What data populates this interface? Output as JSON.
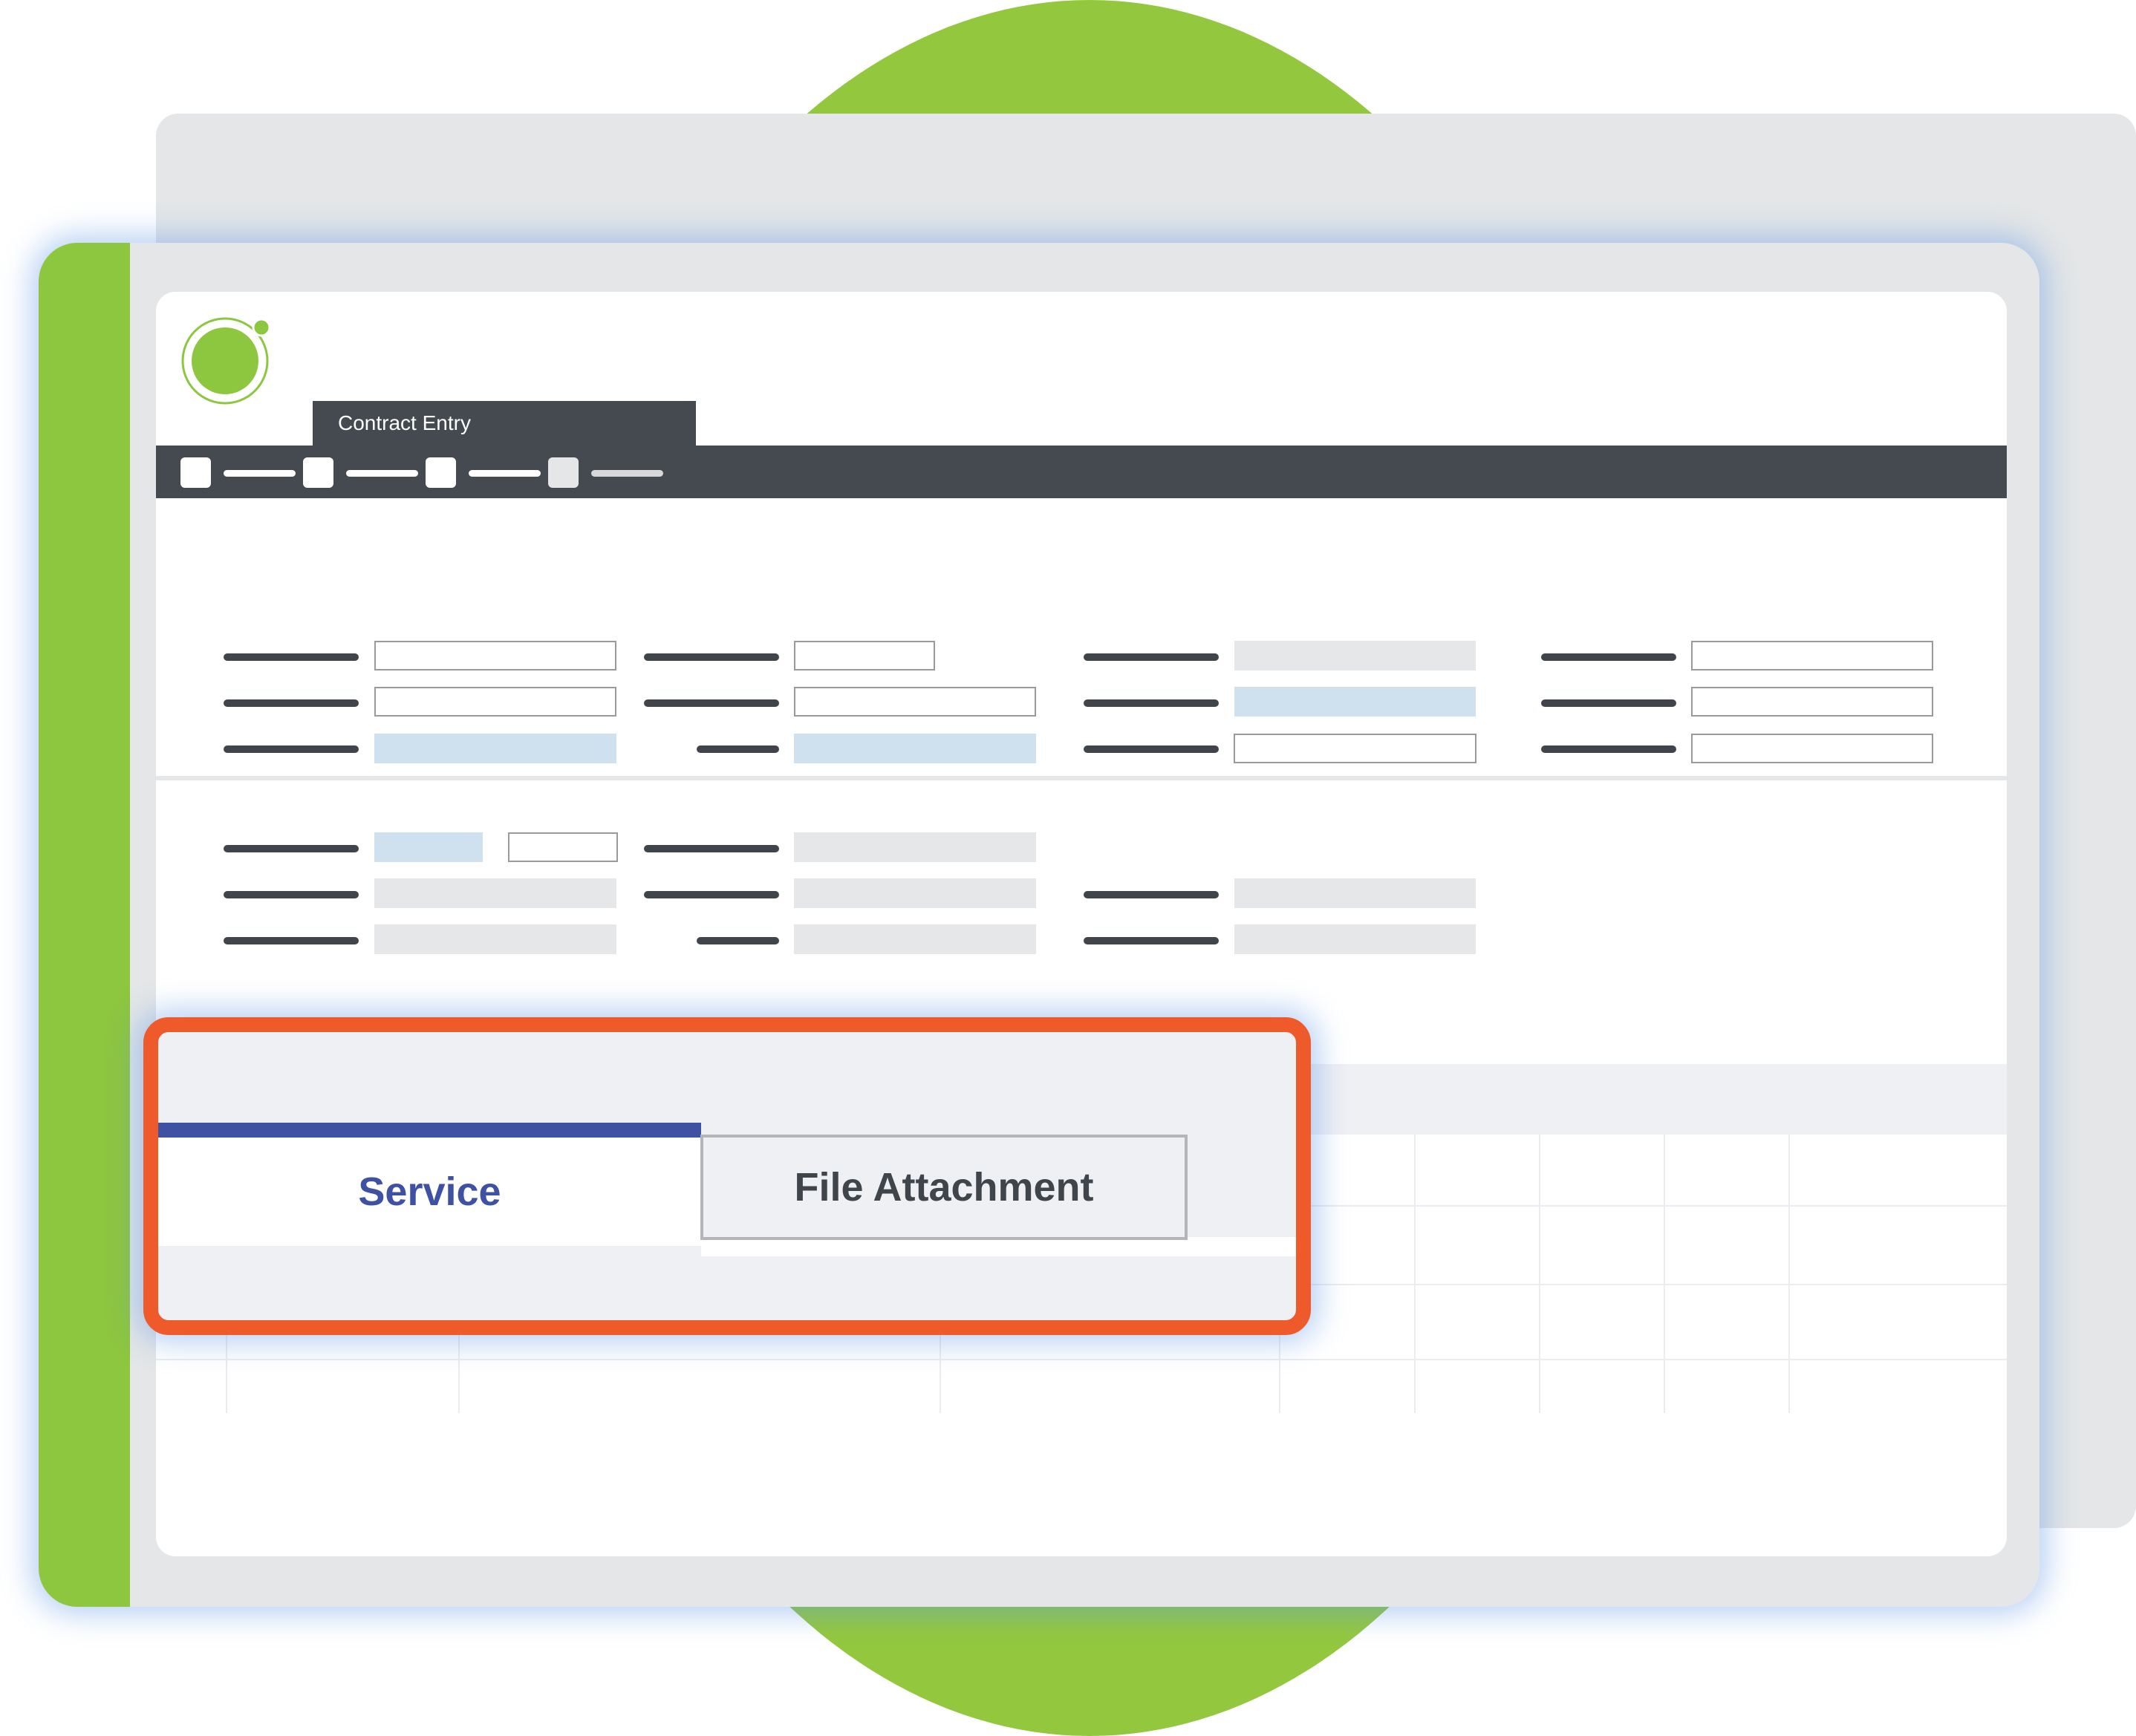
{
  "window": {
    "tab_title": "Contract Entry"
  },
  "toolbar": {
    "items": [
      {
        "icon": "toolbar-square-icon"
      },
      {
        "icon": "toolbar-square-icon"
      },
      {
        "icon": "toolbar-square-icon"
      },
      {
        "icon": "toolbar-square-icon"
      }
    ]
  },
  "tabs": {
    "service_label": "Service",
    "file_attachment_label": "File Attachment",
    "active": "Service"
  },
  "colors": {
    "accent_green": "#8dc63f",
    "toolbar_dark": "#444a50",
    "active_tab_blue": "#3f51a3",
    "highlight_orange": "#ef5a2b"
  },
  "icons": {
    "logo": "circle-logo-icon"
  }
}
